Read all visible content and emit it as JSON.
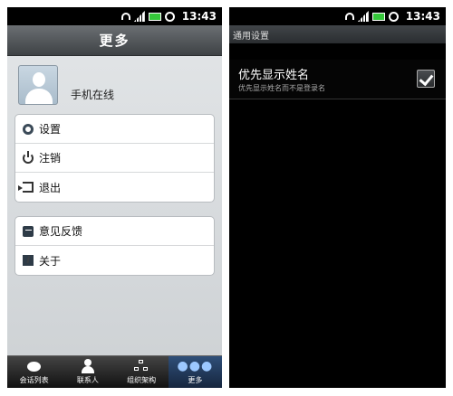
{
  "status_bar": {
    "time": "13:43"
  },
  "left": {
    "title": "更多",
    "profile": {
      "status": "手机在线"
    },
    "menu_group_1": [
      {
        "label": "设置",
        "icon": "gear-icon"
      },
      {
        "label": "注销",
        "icon": "power-icon"
      },
      {
        "label": "退出",
        "icon": "exit-icon"
      }
    ],
    "menu_group_2": [
      {
        "label": "意见反馈",
        "icon": "feedback-icon"
      },
      {
        "label": "关于",
        "icon": "info-icon"
      }
    ],
    "tabs": [
      {
        "label": "会话列表",
        "icon": "chat-bubble-icon"
      },
      {
        "label": "联系人",
        "icon": "contact-icon"
      },
      {
        "label": "组织架构",
        "icon": "org-chart-icon"
      },
      {
        "label": "更多",
        "icon": "more-dots-icon",
        "active": true
      }
    ]
  },
  "right": {
    "title": "通用设置",
    "setting": {
      "title": "优先显示姓名",
      "description": "优先显示姓名而不是登录名",
      "checked": true
    }
  },
  "colors": {
    "active_tab": "#2f4f79",
    "battery": "#35c73a"
  }
}
